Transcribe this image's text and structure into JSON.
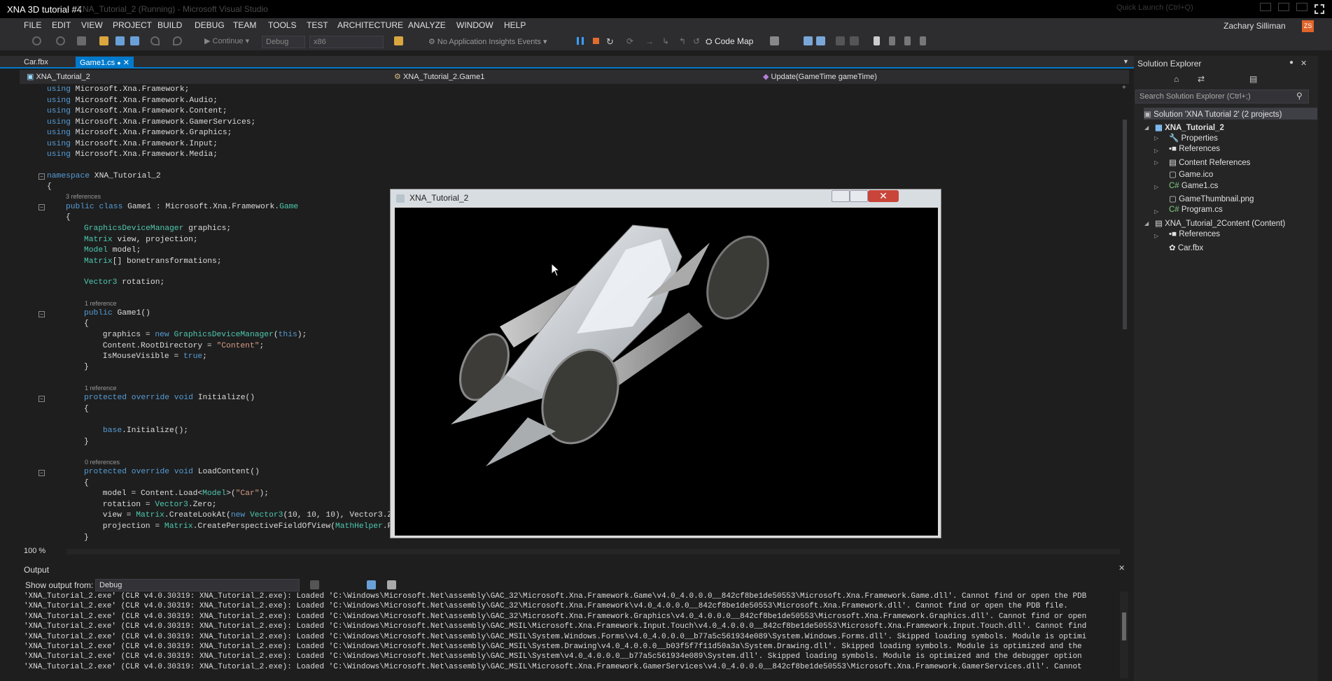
{
  "window": {
    "video_title": "XNA 3D tutorial #4",
    "vs_title": "XNA_Tutorial_2 (Running) - Microsoft Visual Studio",
    "user_name": "Zachary Silliman",
    "user_initials": "ZS",
    "quick_launch": "Quick Launch (Ctrl+Q)"
  },
  "menu": [
    "FILE",
    "EDIT",
    "VIEW",
    "PROJECT",
    "BUILD",
    "DEBUG",
    "TEAM",
    "TOOLS",
    "TEST",
    "ARCHITECTURE",
    "ANALYZE",
    "WINDOW",
    "HELP"
  ],
  "toolbar": {
    "continue_label": "Continue",
    "config": "Debug",
    "platform": "x86",
    "insights": "No Application Insights Events",
    "code_map": "Code Map"
  },
  "tabs": [
    {
      "label": "Car.fbx"
    },
    {
      "label": "Game1.cs"
    }
  ],
  "navbar": {
    "project": "XNA_Tutorial_2",
    "class": "XNA_Tutorial_2.Game1",
    "member": "Update(GameTime gameTime)"
  },
  "code": {
    "l1": [
      "using",
      " Microsoft.Xna.Framework;"
    ],
    "l2": [
      "using",
      " Microsoft.Xna.Framework.Audio;"
    ],
    "l3": [
      "using",
      " Microsoft.Xna.Framework.Content;"
    ],
    "l4": [
      "using",
      " Microsoft.Xna.Framework.GamerServices;"
    ],
    "l5": [
      "using",
      " Microsoft.Xna.Framework.Graphics;"
    ],
    "l6": [
      "using",
      " Microsoft.Xna.Framework.Input;"
    ],
    "l7": [
      "using",
      " Microsoft.Xna.Framework.Media;"
    ],
    "ns": [
      "namespace",
      " XNA_Tutorial_2"
    ],
    "lens_class": "3 references",
    "cls": [
      "public class",
      " Game1 : Microsoft.Xna.Framework.",
      "Game"
    ],
    "f1": [
      "GraphicsDeviceManager",
      " graphics;"
    ],
    "f2": [
      "Matrix",
      " view, projection;"
    ],
    "f3": [
      "Model",
      " model;"
    ],
    "f4": [
      "Matrix",
      "[] bonetransformations;"
    ],
    "f5": [
      "Vector3",
      " rotation;"
    ],
    "lens_ctor": "1 reference",
    "ctor": [
      "public",
      " Game1()"
    ],
    "c1": [
      " graphics = ",
      "new",
      " ",
      "GraphicsDeviceManager",
      "(",
      "this",
      ");"
    ],
    "c2": [
      " Content.RootDirectory = ",
      "\"Content\"",
      ";"
    ],
    "c3": [
      " IsMouseVisible = ",
      "true",
      ";"
    ],
    "lens_init": "1 reference",
    "init": [
      "protected override void",
      " Initialize()"
    ],
    "i1": [
      "base",
      ".Initialize();"
    ],
    "lens_load": "0 references",
    "load": [
      "protected override void",
      " LoadContent()"
    ],
    "d1": [
      " model = Content.Load<",
      "Model",
      ">(",
      "\"Car\"",
      ");"
    ],
    "d2": [
      " rotation = ",
      "Vector3",
      ".Zero;"
    ],
    "d3": [
      " view = ",
      "Matrix",
      ".CreateLookAt(",
      "new",
      " ",
      "Vector3",
      "(10, 10, 10), Vector3.Z"
    ],
    "d4": [
      " projection = ",
      "Matrix",
      ".CreatePerspectiveFieldOfView(",
      "MathHelper",
      ".Pi"
    ],
    "open": "{",
    "close": "}"
  },
  "zoom": "100 %",
  "output": {
    "title": "Output",
    "show_from_label": "Show output from:",
    "source": "Debug",
    "lines": [
      "'XNA_Tutorial_2.exe' (CLR v4.0.30319: XNA_Tutorial_2.exe): Loaded 'C:\\Windows\\Microsoft.Net\\assembly\\GAC_32\\Microsoft.Xna.Framework.Game\\v4.0_4.0.0.0__842cf8be1de50553\\Microsoft.Xna.Framework.Game.dll'. Cannot find or open the PDB",
      "'XNA_Tutorial_2.exe' (CLR v4.0.30319: XNA_Tutorial_2.exe): Loaded 'C:\\Windows\\Microsoft.Net\\assembly\\GAC_32\\Microsoft.Xna.Framework\\v4.0_4.0.0.0__842cf8be1de50553\\Microsoft.Xna.Framework.dll'. Cannot find or open the PDB file.",
      "'XNA_Tutorial_2.exe' (CLR v4.0.30319: XNA_Tutorial_2.exe): Loaded 'C:\\Windows\\Microsoft.Net\\assembly\\GAC_32\\Microsoft.Xna.Framework.Graphics\\v4.0_4.0.0.0__842cf8be1de50553\\Microsoft.Xna.Framework.Graphics.dll'. Cannot find or open",
      "'XNA_Tutorial_2.exe' (CLR v4.0.30319: XNA_Tutorial_2.exe): Loaded 'C:\\Windows\\Microsoft.Net\\assembly\\GAC_MSIL\\Microsoft.Xna.Framework.Input.Touch\\v4.0_4.0.0.0__842cf8be1de50553\\Microsoft.Xna.Framework.Input.Touch.dll'. Cannot find",
      "'XNA_Tutorial_2.exe' (CLR v4.0.30319: XNA_Tutorial_2.exe): Loaded 'C:\\Windows\\Microsoft.Net\\assembly\\GAC_MSIL\\System.Windows.Forms\\v4.0_4.0.0.0__b77a5c561934e089\\System.Windows.Forms.dll'. Skipped loading symbols. Module is optimi",
      "'XNA_Tutorial_2.exe' (CLR v4.0.30319: XNA_Tutorial_2.exe): Loaded 'C:\\Windows\\Microsoft.Net\\assembly\\GAC_MSIL\\System.Drawing\\v4.0_4.0.0.0__b03f5f7f11d50a3a\\System.Drawing.dll'. Skipped loading symbols. Module is optimized and the",
      "'XNA_Tutorial_2.exe' (CLR v4.0.30319: XNA_Tutorial_2.exe): Loaded 'C:\\Windows\\Microsoft.Net\\assembly\\GAC_MSIL\\System\\v4.0_4.0.0.0__b77a5c561934e089\\System.dll'. Skipped loading symbols. Module is optimized and the debugger option",
      "'XNA_Tutorial_2.exe' (CLR v4.0.30319: XNA_Tutorial_2.exe): Loaded 'C:\\Windows\\Microsoft.Net\\assembly\\GAC_MSIL\\Microsoft.Xna.Framework.GamerServices\\v4.0_4.0.0.0__842cf8be1de50553\\Microsoft.Xna.Framework.GamerServices.dll'. Cannot"
    ]
  },
  "solution_explorer": {
    "title": "Solution Explorer",
    "search_placeholder": "Search Solution Explorer (Ctrl+;)",
    "items": [
      {
        "label": "Solution 'XNA Tutorial 2' (2 projects)"
      },
      {
        "label": "XNA_Tutorial_2"
      },
      {
        "label": "Properties"
      },
      {
        "label": "References"
      },
      {
        "label": "Content References"
      },
      {
        "label": "Game.ico"
      },
      {
        "label": "Game1.cs"
      },
      {
        "label": "GameThumbnail.png"
      },
      {
        "label": "Program.cs"
      },
      {
        "label": "XNA_Tutorial_2Content (Content)"
      },
      {
        "label": "References"
      },
      {
        "label": "Car.fbx"
      }
    ]
  },
  "game_window": {
    "title": "XNA_Tutorial_2"
  }
}
